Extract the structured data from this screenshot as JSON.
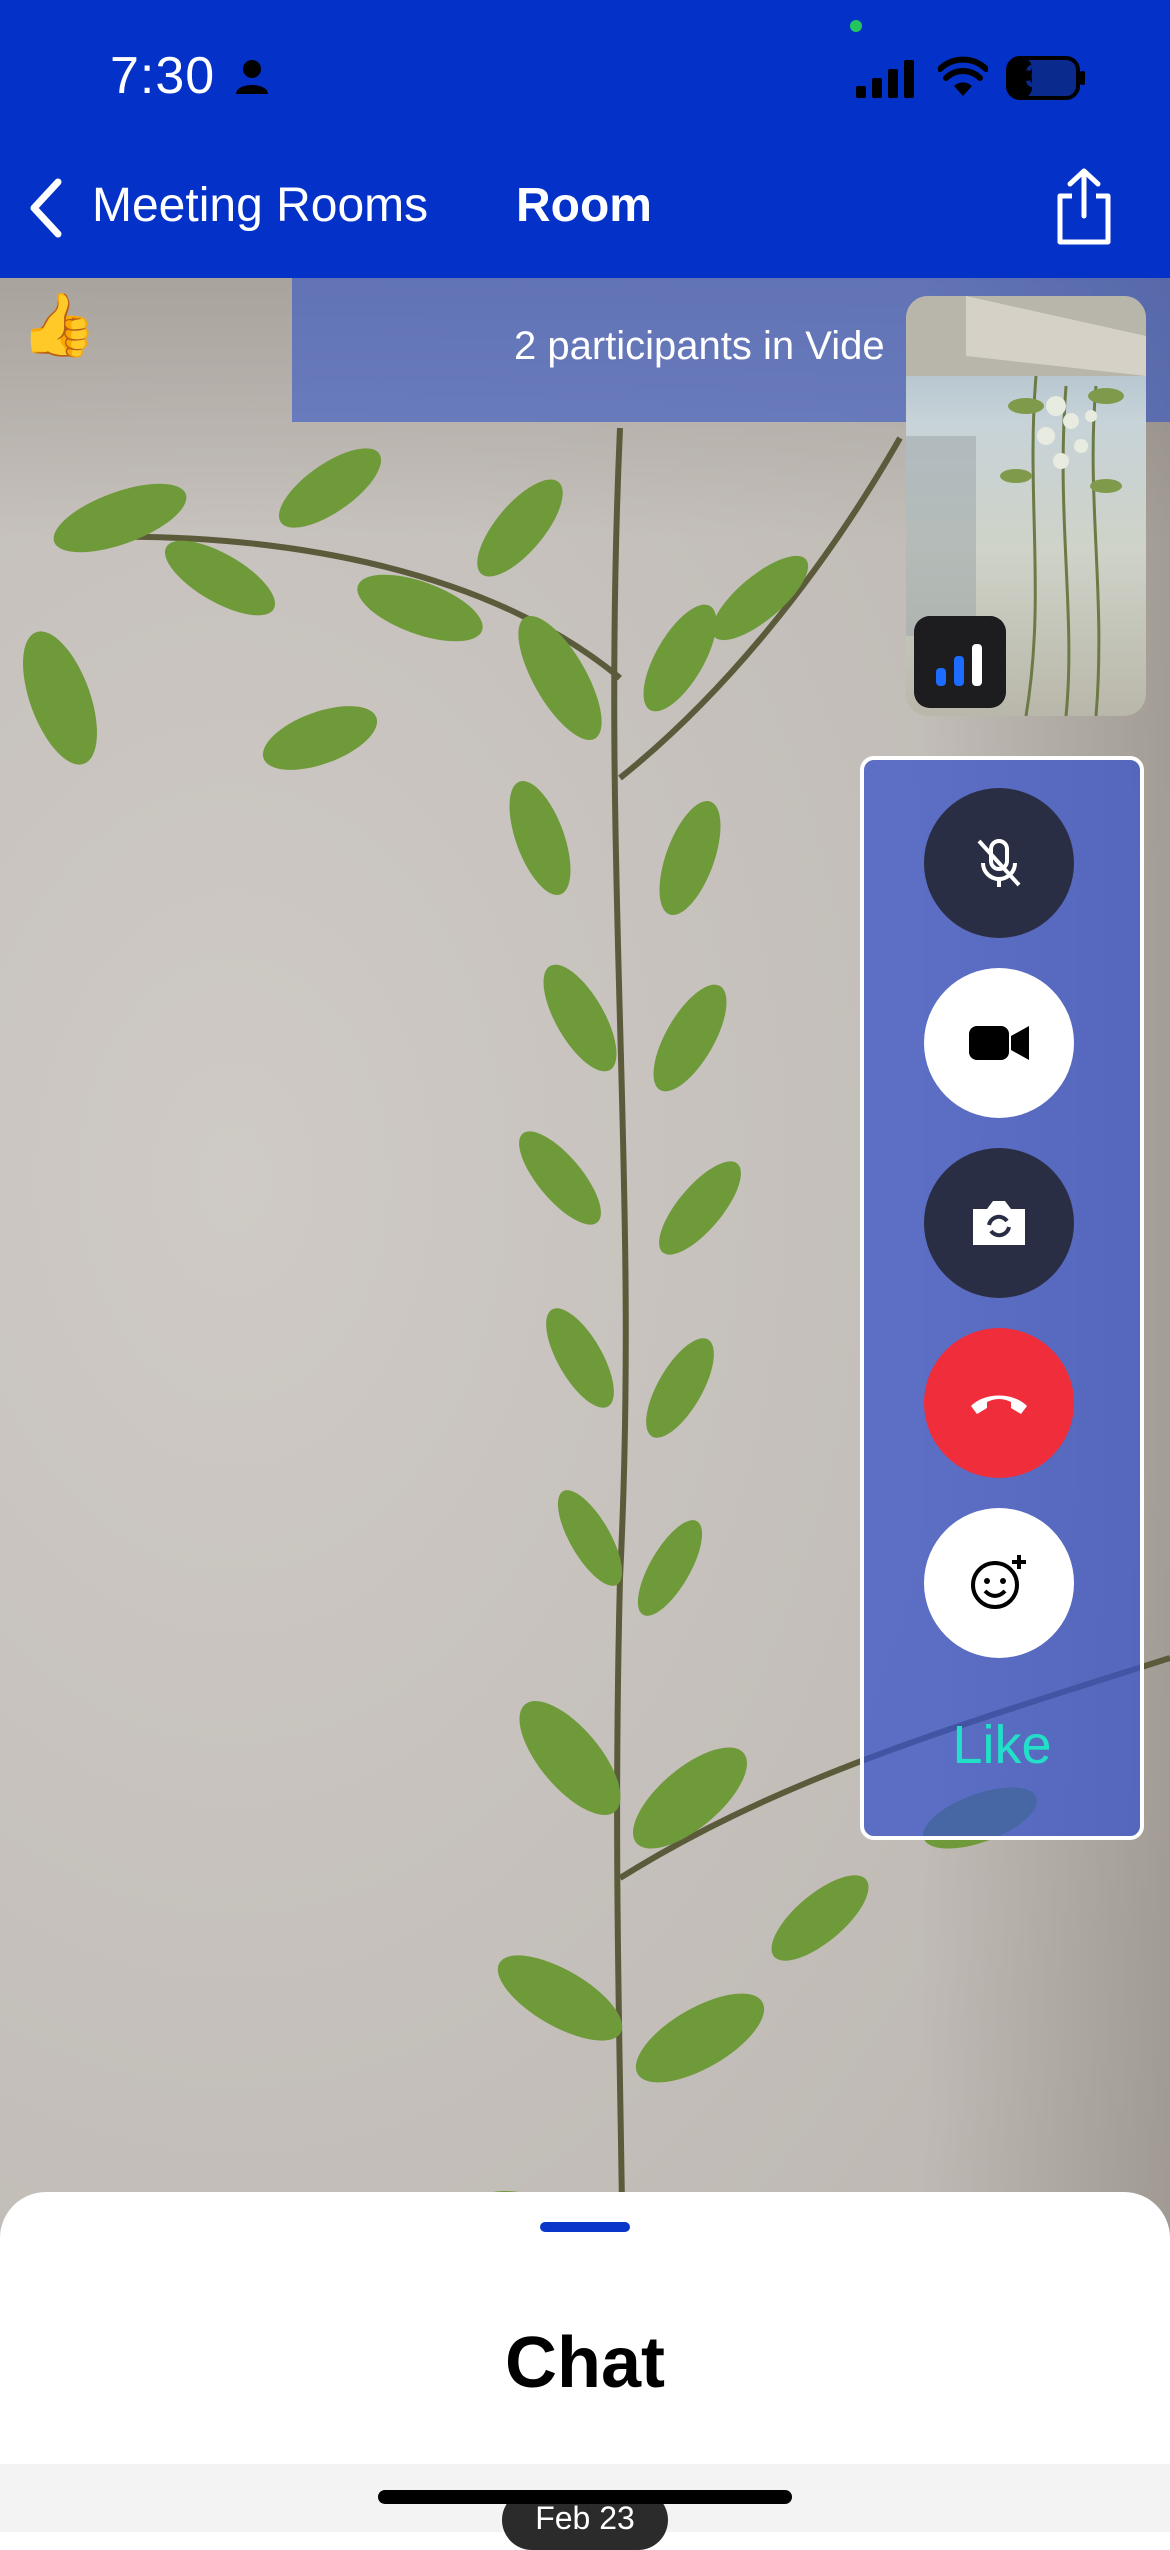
{
  "status_bar": {
    "time": "7:30",
    "battery": "35"
  },
  "nav": {
    "back_label": "Meeting Rooms",
    "title": "Room"
  },
  "video": {
    "participants_text": "2 participants in Vide",
    "reaction_emoji": "👍"
  },
  "controls": {
    "like_label": "Like",
    "buttons": [
      "mic-muted-icon",
      "video-camera-icon",
      "switch-camera-icon",
      "end-call-icon",
      "add-reaction-icon"
    ]
  },
  "chat": {
    "title": "Chat",
    "date_label": "Feb 23"
  },
  "colors": {
    "header_bg": "#0432c8",
    "accent": "#0a37c9",
    "end_call": "#f02d3a",
    "like_text": "#22e0c8"
  }
}
